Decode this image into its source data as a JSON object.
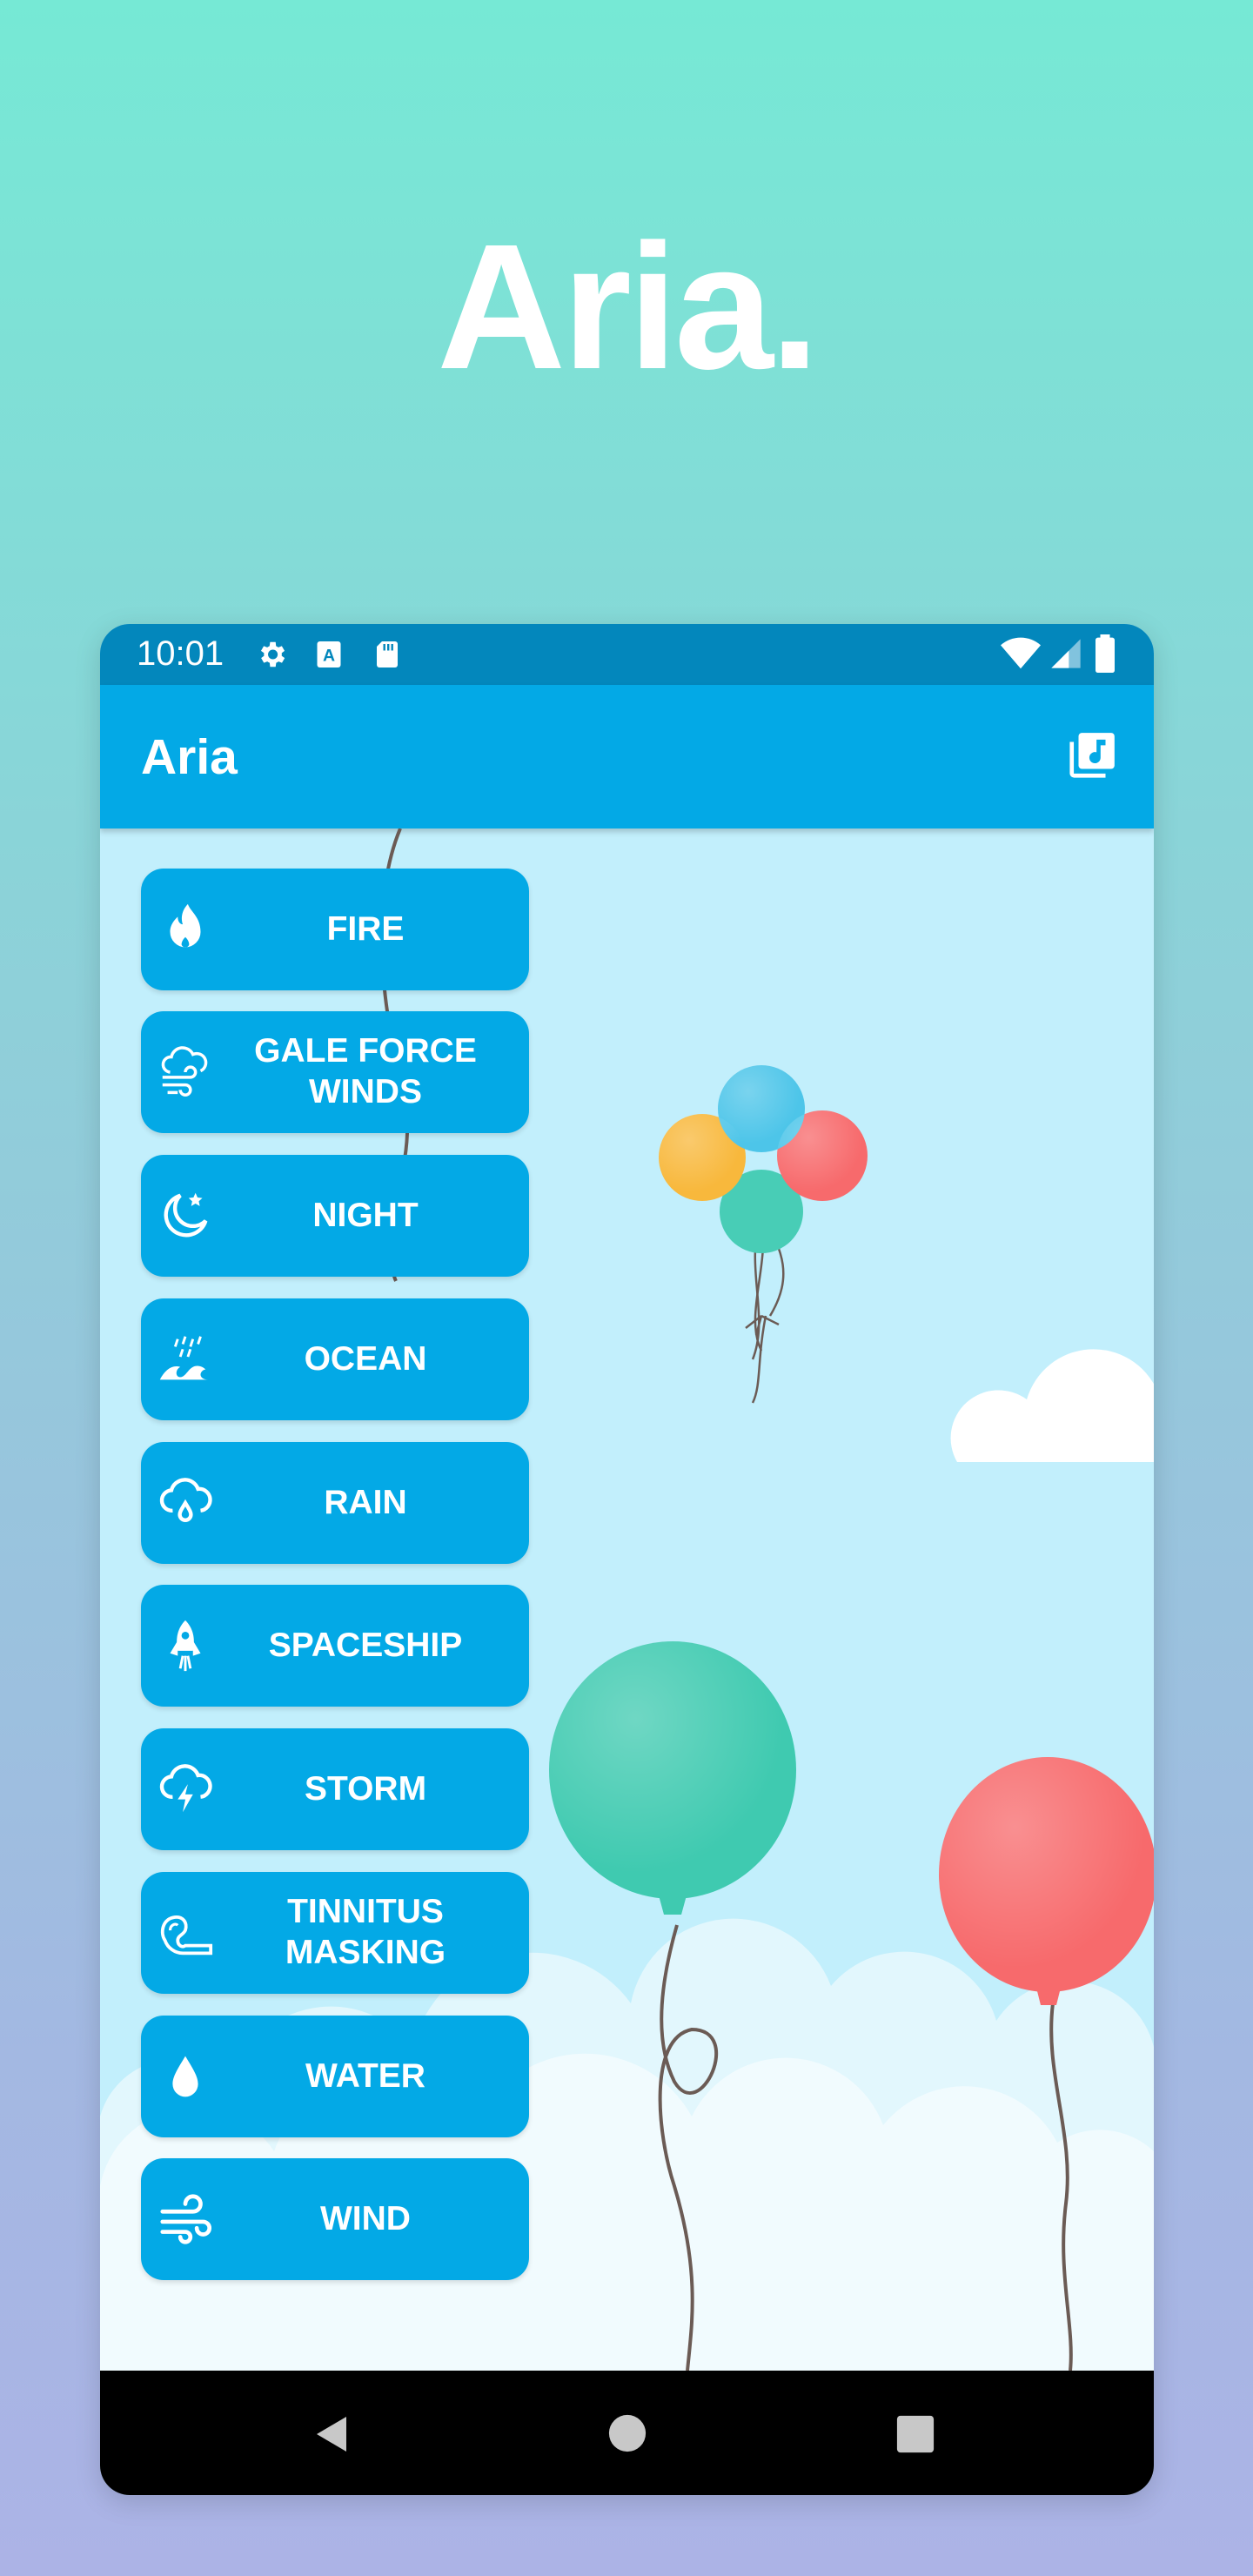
{
  "hero": {
    "title": "Aria."
  },
  "status_bar": {
    "time": "10:01"
  },
  "app_bar": {
    "title": "Aria",
    "action_icon": "music-library-icon"
  },
  "sounds": [
    {
      "label": "FIRE",
      "icon": "fire-icon"
    },
    {
      "label": "GALE FORCE WINDS",
      "icon": "wind-cloud-icon"
    },
    {
      "label": "NIGHT",
      "icon": "moon-star-icon"
    },
    {
      "label": "OCEAN",
      "icon": "waves-icon"
    },
    {
      "label": "RAIN",
      "icon": "rain-cloud-icon"
    },
    {
      "label": "SPACESHIP",
      "icon": "rocket-icon"
    },
    {
      "label": "STORM",
      "icon": "storm-cloud-icon"
    },
    {
      "label": "TINNITUS MASKING",
      "icon": "ear-icon"
    },
    {
      "label": "WATER",
      "icon": "water-drop-icon"
    },
    {
      "label": "WIND",
      "icon": "wind-icon"
    }
  ],
  "colors": {
    "status_bar": "#0387bc",
    "app_bar": "#03a9e6",
    "button": "#03a9e6",
    "sky": "#c2effc"
  }
}
